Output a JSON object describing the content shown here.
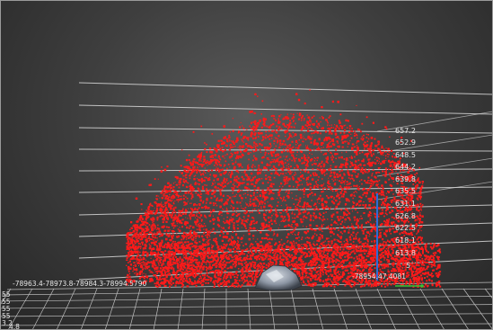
{
  "viewer": {
    "colors": {
      "background": "#3b3b3b",
      "points": "#ff1a1a",
      "gridlines": "#d9d9d9",
      "vertical_axis": "#2e6bd6",
      "accent_green": "#35c435",
      "object": "#8c95a3"
    },
    "z_axis_ticks": [
      "657.2",
      "652.9",
      "648.5",
      "644.2",
      "639.8",
      "635.5",
      "631.1",
      "626.8",
      "622.5",
      "618.1",
      "613.8",
      "5"
    ],
    "x_axis_labels": [
      "-78963.4",
      "-78973.8",
      "-78984.3",
      "-78994.5790"
    ],
    "x_axis_right_label": "-78954.47,4081",
    "y_axis_labels": [
      "55",
      "55",
      "55",
      "55",
      "3.2",
      "4.8"
    ],
    "point_cloud_icon": "point-cloud-icon",
    "scan_object_icon": "scan-object-icon"
  }
}
